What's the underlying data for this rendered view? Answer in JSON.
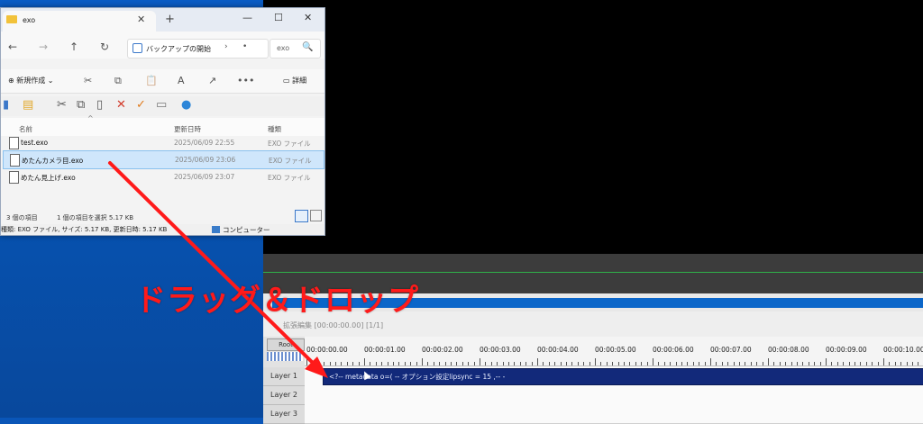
{
  "explorer": {
    "tab_title": "exo",
    "tab_close": "✕",
    "new_tab": "+",
    "window_controls": {
      "minimize": "—",
      "maximize": "☐",
      "close": "✕"
    },
    "nav": {
      "back": "←",
      "forward": "→",
      "up": "↑",
      "refresh": "↻"
    },
    "address_text": "バックアップの開始",
    "address_sep": "›",
    "address_more": "•",
    "search_value": "exo",
    "search_icon": "🔍",
    "toolbar": {
      "new_label": "⊕ 新規作成 ⌄",
      "cut": "✂",
      "copy": "⧉",
      "paste": "📋",
      "rename": "A",
      "share": "↗",
      "more": "•••",
      "details_label": "▭ 詳細"
    },
    "columns": {
      "name": "名前",
      "date": "更新日時",
      "type": "種類"
    },
    "sort_indicator": "^",
    "files": [
      {
        "name": "test.exo",
        "date": "2025/06/09 22:55",
        "type": "EXO ファイル"
      },
      {
        "name": "めたんカメラ目.exo",
        "date": "2025/06/09 23:06",
        "type": "EXO ファイル"
      },
      {
        "name": "めたん見上げ.exo",
        "date": "2025/06/09 23:07",
        "type": "EXO ファイル"
      }
    ],
    "status": {
      "count": "3 個の項目",
      "selected": "1 個の項目を選択  5.17 KB"
    },
    "bottom_info": "種類: EXO ファイル, サイズ: 5.17 KB, 更新日時: 5.17 KB",
    "computer_label": "コンピューター"
  },
  "timeline": {
    "header_text": "拡張編集 [00:00:00.00] [1/1]",
    "root_label": "Root",
    "ticks": [
      "00:00:00.00",
      "00:00:01.00",
      "00:00:02.00",
      "00:00:03.00",
      "00:00:04.00",
      "00:00:05.00",
      "00:00:06.00",
      "00:00:07.00",
      "00:00:08.00",
      "00:00:09.00",
      "00:00:10.00"
    ],
    "layers": [
      "Layer 1",
      "Layer 2",
      "Layer 3"
    ],
    "clip_text": "<?-- metadata o=( -- オプション設定lipsync = 15  ,-- -"
  },
  "annotation": {
    "text": "ドラッグ＆ドロップ",
    "color": "#ff1a1a"
  }
}
